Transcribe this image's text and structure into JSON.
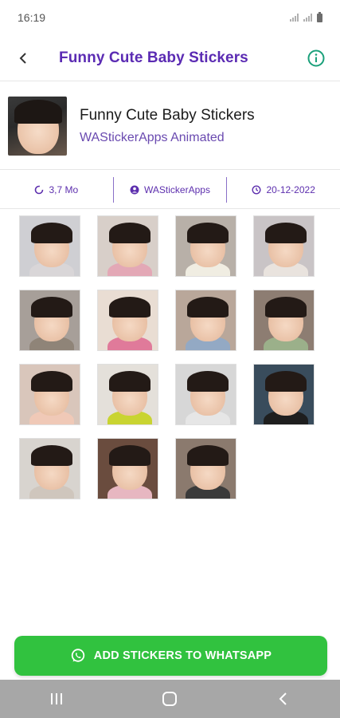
{
  "status_bar": {
    "time": "16:19"
  },
  "app_bar": {
    "title": "Funny Cute Baby Stickers"
  },
  "pack": {
    "name": "Funny Cute Baby Stickers",
    "publisher": "WAStickerApps Animated"
  },
  "meta": {
    "size": "3,7 Mo",
    "author": "WAStickerApps",
    "date": "20-12-2022"
  },
  "stickers": [
    {
      "bg": "#cfcfd3",
      "shirt": "#d9d6d8"
    },
    {
      "bg": "#d8cfc9",
      "shirt": "#e3a8b6"
    },
    {
      "bg": "#b8b0a8",
      "shirt": "#f0ede2"
    },
    {
      "bg": "#c9c4c6",
      "shirt": "#e9e3de"
    },
    {
      "bg": "#a79f99",
      "shirt": "#8f8478"
    },
    {
      "bg": "#e9ddd3",
      "shirt": "#e07a9a"
    },
    {
      "bg": "#b9a79a",
      "shirt": "#93a9c4"
    },
    {
      "bg": "#8d7d72",
      "shirt": "#9bb08a"
    },
    {
      "bg": "#d9c6bb",
      "shirt": "#f0c9b7"
    },
    {
      "bg": "#e4e0da",
      "shirt": "#c9d431"
    },
    {
      "bg": "#d7d7d7",
      "shirt": "#e6e6e6"
    },
    {
      "bg": "#394c5c",
      "shirt": "#1e1e1e"
    },
    {
      "bg": "#d8d4cf",
      "shirt": "#cfc6bd"
    },
    {
      "bg": "#6a4c3e",
      "shirt": "#e7b7c1"
    },
    {
      "bg": "#8b7a6e",
      "shirt": "#3a3a3a"
    }
  ],
  "add_button": {
    "label": "ADD STICKERS TO WHATSAPP"
  },
  "colors": {
    "accent": "#5b2bb3",
    "whatsapp_green": "#31c23f",
    "info_icon": "#1aa07a"
  },
  "icons": {
    "back": "back-arrow-icon",
    "info": "info-icon",
    "size": "loading-circle-icon",
    "author": "person-icon",
    "date": "clock-icon",
    "whatsapp": "whatsapp-icon",
    "nav_recent": "recent-apps-icon",
    "nav_home": "home-icon",
    "nav_back": "nav-back-icon"
  }
}
